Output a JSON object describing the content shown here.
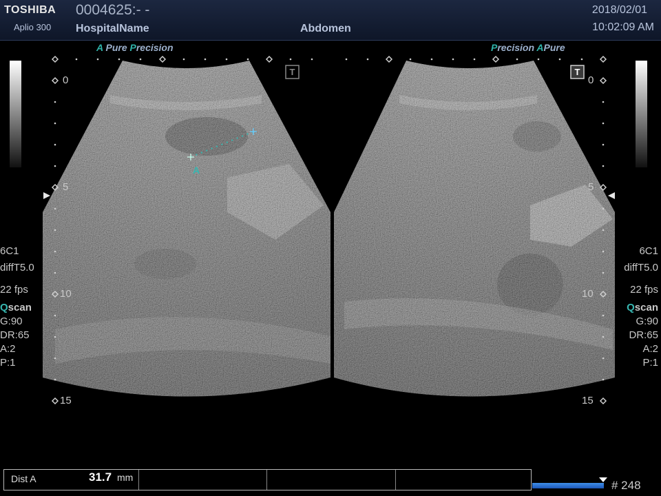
{
  "header": {
    "brand": "TOSHIBA",
    "model": "Aplio 300",
    "patient_id": "0004625:- -",
    "hospital": "HospitalName",
    "exam": "Abdomen",
    "date": "2018/02/01",
    "time": "10:02:09 AM"
  },
  "left_panel": {
    "mode_a": "A",
    "mode_pure": "Pure",
    "mode_p": "P",
    "mode_precision": "recision",
    "depth_labels": [
      "0",
      "5",
      "10",
      "15"
    ],
    "probe": "6C1",
    "preset": "diffT5.0",
    "fps": "22 fps",
    "qscan_q": "Q",
    "qscan_rest": "scan",
    "gain": "G:90",
    "dr": "DR:65",
    "a": "A:2",
    "p": "P:1",
    "marker_t": "T",
    "caliper_label": "A"
  },
  "right_panel": {
    "mode_p": "P",
    "mode_precision": "recision",
    "mode_a": "A",
    "mode_pure": "Pure",
    "depth_labels": [
      "0",
      "5",
      "10",
      "15"
    ],
    "probe": "6C1",
    "preset": "diffT5.0",
    "fps": "22 fps",
    "qscan_q": "Q",
    "qscan_rest": "scan",
    "gain": "G:90",
    "dr": "DR:65",
    "a": "A:2",
    "p": "P:1",
    "marker_t": "T"
  },
  "measurement": {
    "name": "Dist A",
    "value": "31.7",
    "unit": "mm"
  },
  "cine": {
    "frame": "# 248"
  },
  "colors": {
    "teal": "#37b6b0",
    "cine_blue": "#2f72d6"
  }
}
